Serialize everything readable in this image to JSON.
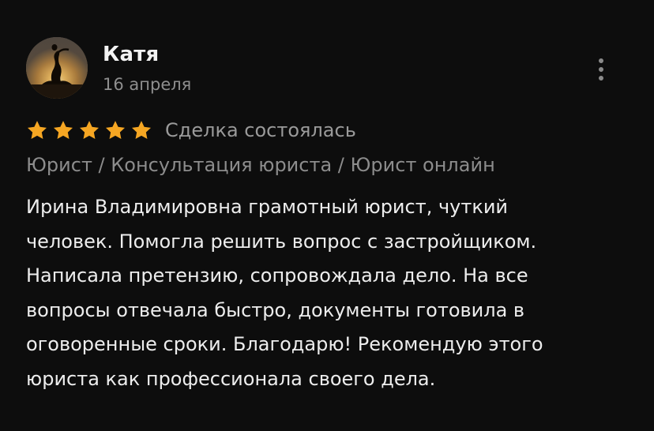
{
  "review": {
    "author": "Катя",
    "date": "16 апреля",
    "rating": 5,
    "rating_max": 5,
    "star_color": "#f5a623",
    "deal_status": "Сделка состоялась",
    "category_path": "Юрист / Консультация юриста / Юрист онлайн",
    "text_lines": [
      "Ирина Владимировна грамотный юрист, чуткий",
      "человек. Помогла решить вопрос с застройщиком.",
      "Написала претензию, сопровождала дело. На все",
      "вопросы отвечала быстро, документы готовила в",
      "оговоренные сроки. Благодарю! Рекомендую этого",
      "юриста как профессионала своего дела."
    ]
  },
  "icons": {
    "avatar": "avatar-sunset-silhouette",
    "menu": "more-vertical-icon",
    "star": "star-icon"
  }
}
